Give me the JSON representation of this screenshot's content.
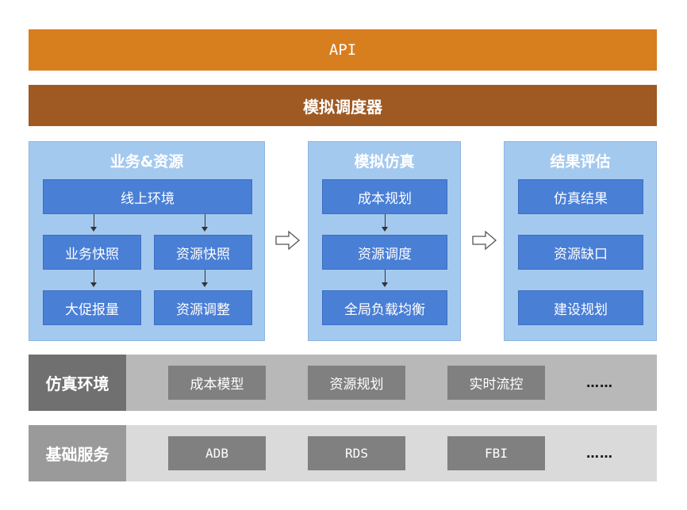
{
  "api": {
    "label": "API"
  },
  "scheduler": {
    "label": "模拟调度器"
  },
  "panels": {
    "business": {
      "title": "业务&资源",
      "online_env": "线上环境",
      "biz_snapshot": "业务快照",
      "res_snapshot": "资源快照",
      "promo_volume": "大促报量",
      "res_adjust": "资源调整"
    },
    "simulation": {
      "title": "模拟仿真",
      "items": [
        "成本规划",
        "资源调度",
        "全局负载均衡"
      ]
    },
    "evaluation": {
      "title": "结果评估",
      "items": [
        "仿真结果",
        "资源缺口",
        "建设规划"
      ]
    }
  },
  "sim_env": {
    "label": "仿真环境",
    "items": [
      "成本模型",
      "资源规划",
      "实时流控"
    ],
    "more": "……"
  },
  "base_services": {
    "label": "基础服务",
    "items": [
      "ADB",
      "RDS",
      "FBI"
    ],
    "more": "……"
  },
  "colors": {
    "api": "#d77e1f",
    "scheduler": "#9e5a22",
    "panel": "#a4c9ef",
    "block": "#4a7fd6",
    "sim_env_label": "#707070",
    "sim_env_bg": "#b8b8b8",
    "base_label": "#9a9a9a",
    "base_bg": "#dadada",
    "row_item": "#808080"
  }
}
